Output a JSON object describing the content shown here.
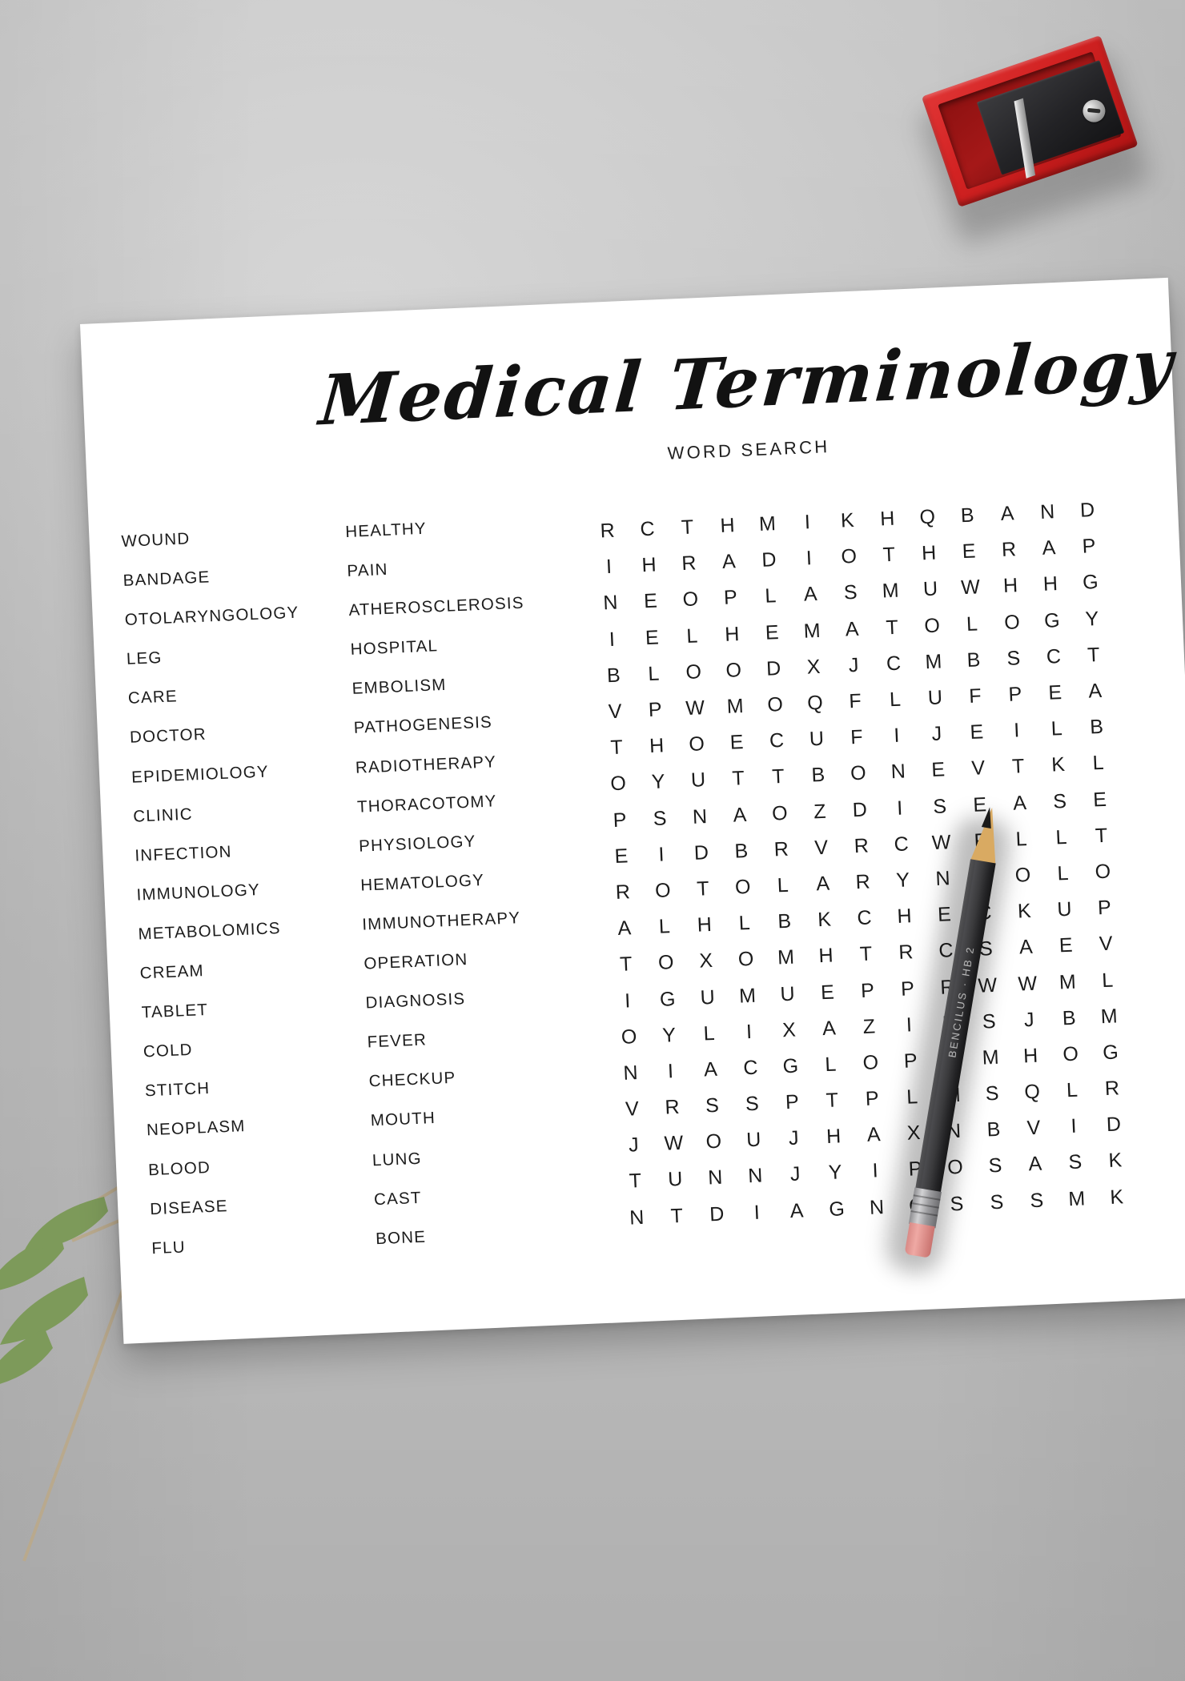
{
  "header": {
    "title": "Medical Terminology",
    "subtitle": "WORD SEARCH"
  },
  "word_list": {
    "column_1": [
      "WOUND",
      "BANDAGE",
      "OTOLARYNGOLOGY",
      "LEG",
      "CARE",
      "DOCTOR",
      "EPIDEMIOLOGY",
      "CLINIC",
      "INFECTION",
      "IMMUNOLOGY",
      "METABOLOMICS",
      "CREAM",
      "TABLET",
      "COLD",
      "STITCH",
      "NEOPLASM",
      "BLOOD",
      "DISEASE",
      "FLU"
    ],
    "column_2": [
      "HEALTHY",
      "PAIN",
      "ATHEROSCLEROSIS",
      "HOSPITAL",
      "EMBOLISM",
      "PATHOGENESIS",
      "RADIOTHERAPY",
      "THORACOTOMY",
      "PHYSIOLOGY",
      "HEMATOLOGY",
      "IMMUNOTHERAPY",
      "OPERATION",
      "DIAGNOSIS",
      "FEVER",
      "CHECKUP",
      "MOUTH",
      "LUNG",
      "CAST",
      "BONE"
    ]
  },
  "grid": {
    "columns": 14,
    "rows": 19,
    "letters": [
      [
        "R",
        "C",
        "T",
        "H",
        "M",
        "I",
        "K",
        "H",
        "Q",
        "B",
        "A",
        "N",
        "D",
        ""
      ],
      [
        "I",
        "H",
        "R",
        "A",
        "D",
        "I",
        "O",
        "T",
        "H",
        "E",
        "R",
        "A",
        "P",
        ""
      ],
      [
        "N",
        "E",
        "O",
        "P",
        "L",
        "A",
        "S",
        "M",
        "U",
        "W",
        "H",
        "H",
        "G",
        ""
      ],
      [
        "I",
        "E",
        "L",
        "H",
        "E",
        "M",
        "A",
        "T",
        "O",
        "L",
        "O",
        "G",
        "Y",
        ""
      ],
      [
        "B",
        "L",
        "O",
        "O",
        "D",
        "X",
        "J",
        "C",
        "M",
        "B",
        "S",
        "C",
        "T",
        ""
      ],
      [
        "V",
        "P",
        "W",
        "M",
        "O",
        "Q",
        "F",
        "L",
        "U",
        "F",
        "P",
        "E",
        "A",
        ""
      ],
      [
        "T",
        "H",
        "O",
        "E",
        "C",
        "U",
        "F",
        "I",
        "J",
        "E",
        "I",
        "L",
        "B",
        ""
      ],
      [
        "O",
        "Y",
        "U",
        "T",
        "T",
        "B",
        "O",
        "N",
        "E",
        "V",
        "T",
        "K",
        "L",
        ""
      ],
      [
        "P",
        "S",
        "N",
        "A",
        "O",
        "Z",
        "D",
        "I",
        "S",
        "E",
        "A",
        "S",
        "E",
        ""
      ],
      [
        "E",
        "I",
        "D",
        "B",
        "R",
        "V",
        "R",
        "C",
        "W",
        "R",
        "L",
        "L",
        "T",
        ""
      ],
      [
        "R",
        "O",
        "T",
        "O",
        "L",
        "A",
        "R",
        "Y",
        "N",
        "G",
        "O",
        "L",
        "O",
        ""
      ],
      [
        "A",
        "L",
        "H",
        "L",
        "B",
        "K",
        "C",
        "H",
        "E",
        "C",
        "K",
        "U",
        "P",
        ""
      ],
      [
        "T",
        "O",
        "X",
        "O",
        "M",
        "H",
        "T",
        "R",
        "C",
        "S",
        "A",
        "E",
        "V",
        ""
      ],
      [
        "I",
        "G",
        "U",
        "M",
        "U",
        "E",
        "P",
        "P",
        "R",
        "W",
        "W",
        "M",
        "L",
        ""
      ],
      [
        "O",
        "Y",
        "L",
        "I",
        "X",
        "A",
        "Z",
        "I",
        "E",
        "S",
        "J",
        "B",
        "M",
        ""
      ],
      [
        "N",
        "I",
        "A",
        "C",
        "G",
        "L",
        "O",
        "P",
        "A",
        "M",
        "H",
        "O",
        "G",
        ""
      ],
      [
        "V",
        "R",
        "S",
        "S",
        "P",
        "T",
        "P",
        "L",
        "M",
        "S",
        "Q",
        "L",
        "R",
        ""
      ],
      [
        "J",
        "W",
        "O",
        "U",
        "J",
        "H",
        "A",
        "X",
        "N",
        "B",
        "V",
        "I",
        "D",
        ""
      ],
      [
        "T",
        "U",
        "N",
        "N",
        "J",
        "Y",
        "I",
        "P",
        "O",
        "S",
        "A",
        "S",
        "K",
        ""
      ],
      [
        "N",
        "T",
        "D",
        "I",
        "A",
        "G",
        "N",
        "O",
        "S",
        "S",
        "S",
        "M",
        "K",
        ""
      ]
    ]
  },
  "objects": {
    "sharpener_color": "#d22222",
    "pencil_label": "BENCILUS  ·  HB 2",
    "pencil_body_color": "#333335"
  }
}
